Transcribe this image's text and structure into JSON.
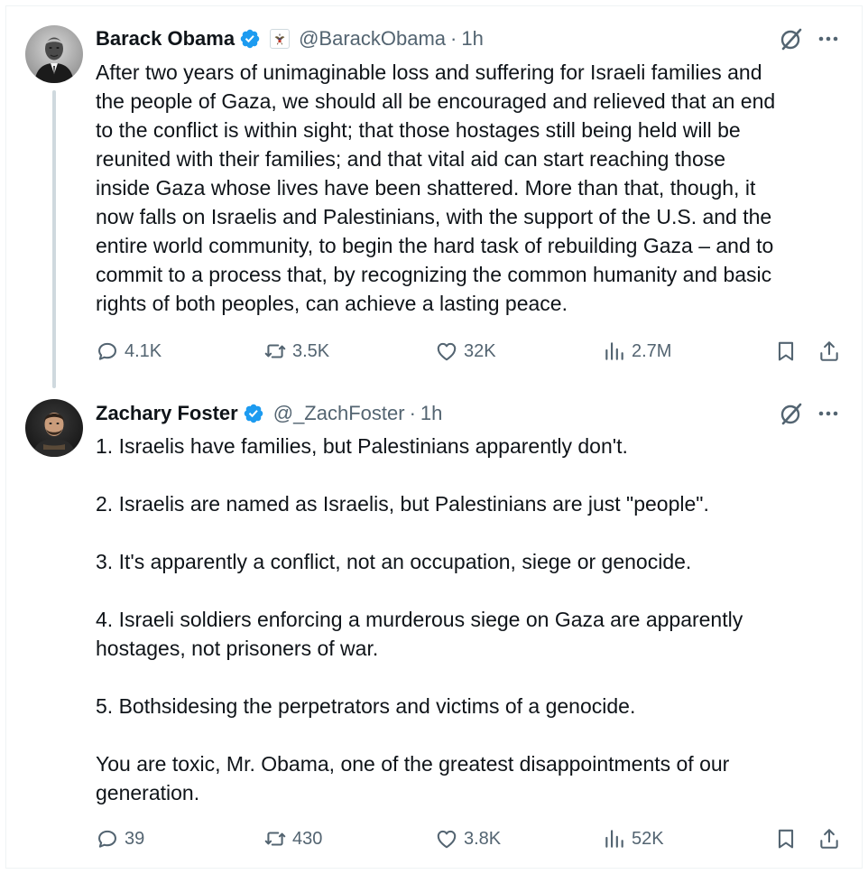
{
  "colors": {
    "verified_blue": "#1d9bf0",
    "text_primary": "#0f1419",
    "text_secondary": "#536471",
    "thread_line": "#cfd9de"
  },
  "tweets": [
    {
      "name": "Barack Obama",
      "handle": "@BarackObama",
      "separator": "·",
      "time": "1h",
      "verified_icon": "verified-badge-icon",
      "affiliation_icon": "us-seal-icon",
      "text": "After two years of unimaginable loss and suffering for Israeli families and\nthe people of Gaza, we should all be encouraged and relieved that an end\nto the conflict is within sight; that those hostages still being held will be\nreunited with their families; and that vital aid can start reaching those\ninside Gaza whose lives have been shattered. More than that, though, it\nnow falls on Israelis and Palestinians, with the support of the U.S. and the\nentire world community, to begin the hard task of rebuilding Gaza – and to\ncommit to a process that, by recognizing the common humanity and basic\nrights of both peoples, can achieve a lasting peace.",
      "replies": "4.1K",
      "reposts": "3.5K",
      "likes": "32K",
      "views": "2.7M"
    },
    {
      "name": "Zachary Foster",
      "handle": "@_ZachFoster",
      "separator": "·",
      "time": "1h",
      "verified_icon": "verified-badge-icon",
      "text": "1. Israelis have families, but Palestinians apparently don't.\n\n2. Israelis are named as Israelis, but Palestinians are just \"people\".\n\n3. It's apparently a conflict, not an occupation, siege or genocide.\n\n4. Israeli soldiers enforcing a murderous siege on Gaza are apparently\nhostages, not prisoners of war.\n\n5. Bothsidesing the perpetrators and victims of a genocide.\n\nYou are toxic, Mr. Obama, one of the greatest disappointments of our\ngeneration.",
      "replies": "39",
      "reposts": "430",
      "likes": "3.8K",
      "views": "52K"
    }
  ]
}
